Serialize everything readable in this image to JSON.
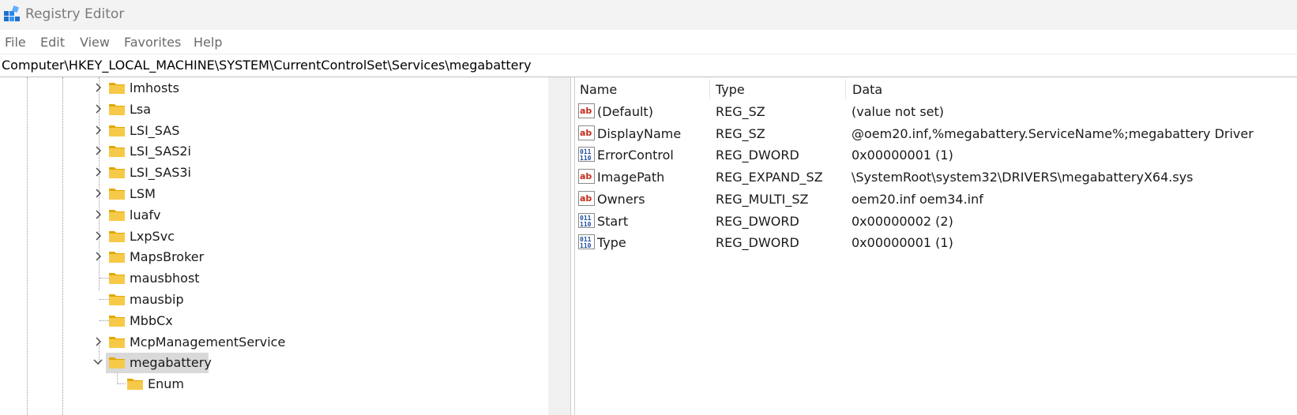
{
  "window": {
    "title": "Registry Editor"
  },
  "menu": [
    "File",
    "Edit",
    "View",
    "Favorites",
    "Help"
  ],
  "address": "Computer\\HKEY_LOCAL_MACHINE\\SYSTEM\\CurrentControlSet\\Services\\megabattery",
  "tree": {
    "items": [
      {
        "label": "lmhosts",
        "expander": "collapsed"
      },
      {
        "label": "Lsa",
        "expander": "collapsed"
      },
      {
        "label": "LSI_SAS",
        "expander": "collapsed"
      },
      {
        "label": "LSI_SAS2i",
        "expander": "collapsed"
      },
      {
        "label": "LSI_SAS3i",
        "expander": "collapsed"
      },
      {
        "label": "LSM",
        "expander": "collapsed"
      },
      {
        "label": "luafv",
        "expander": "collapsed"
      },
      {
        "label": "LxpSvc",
        "expander": "collapsed"
      },
      {
        "label": "MapsBroker",
        "expander": "collapsed"
      },
      {
        "label": "mausbhost",
        "expander": "none"
      },
      {
        "label": "mausbip",
        "expander": "none"
      },
      {
        "label": "MbbCx",
        "expander": "none"
      },
      {
        "label": "McpManagementService",
        "expander": "collapsed"
      },
      {
        "label": "megabattery",
        "expander": "expanded",
        "selected": true
      },
      {
        "label": "Enum",
        "expander": "child"
      }
    ]
  },
  "list": {
    "columns": {
      "name": "Name",
      "type": "Type",
      "data": "Data"
    },
    "rows": [
      {
        "icon": "string-value-icon",
        "name": "(Default)",
        "type": "REG_SZ",
        "data": "(value not set)"
      },
      {
        "icon": "string-value-icon",
        "name": "DisplayName",
        "type": "REG_SZ",
        "data": "@oem20.inf,%megabattery.ServiceName%;megabattery Driver"
      },
      {
        "icon": "binary-value-icon",
        "name": "ErrorControl",
        "type": "REG_DWORD",
        "data": "0x00000001 (1)"
      },
      {
        "icon": "string-value-icon",
        "name": "ImagePath",
        "type": "REG_EXPAND_SZ",
        "data": "\\SystemRoot\\system32\\DRIVERS\\megabatteryX64.sys"
      },
      {
        "icon": "string-value-icon",
        "name": "Owners",
        "type": "REG_MULTI_SZ",
        "data": "oem20.inf oem34.inf"
      },
      {
        "icon": "binary-value-icon",
        "name": "Start",
        "type": "REG_DWORD",
        "data": "0x00000002 (2)"
      },
      {
        "icon": "binary-value-icon",
        "name": "Type",
        "type": "REG_DWORD",
        "data": "0x00000001 (1)"
      }
    ]
  },
  "colors": {
    "folder": "#f7c948",
    "folder_dark": "#e0a800",
    "selection": "#d9d9d9",
    "icon_red": "#c42b1c",
    "icon_blue": "#1f4e9e"
  }
}
